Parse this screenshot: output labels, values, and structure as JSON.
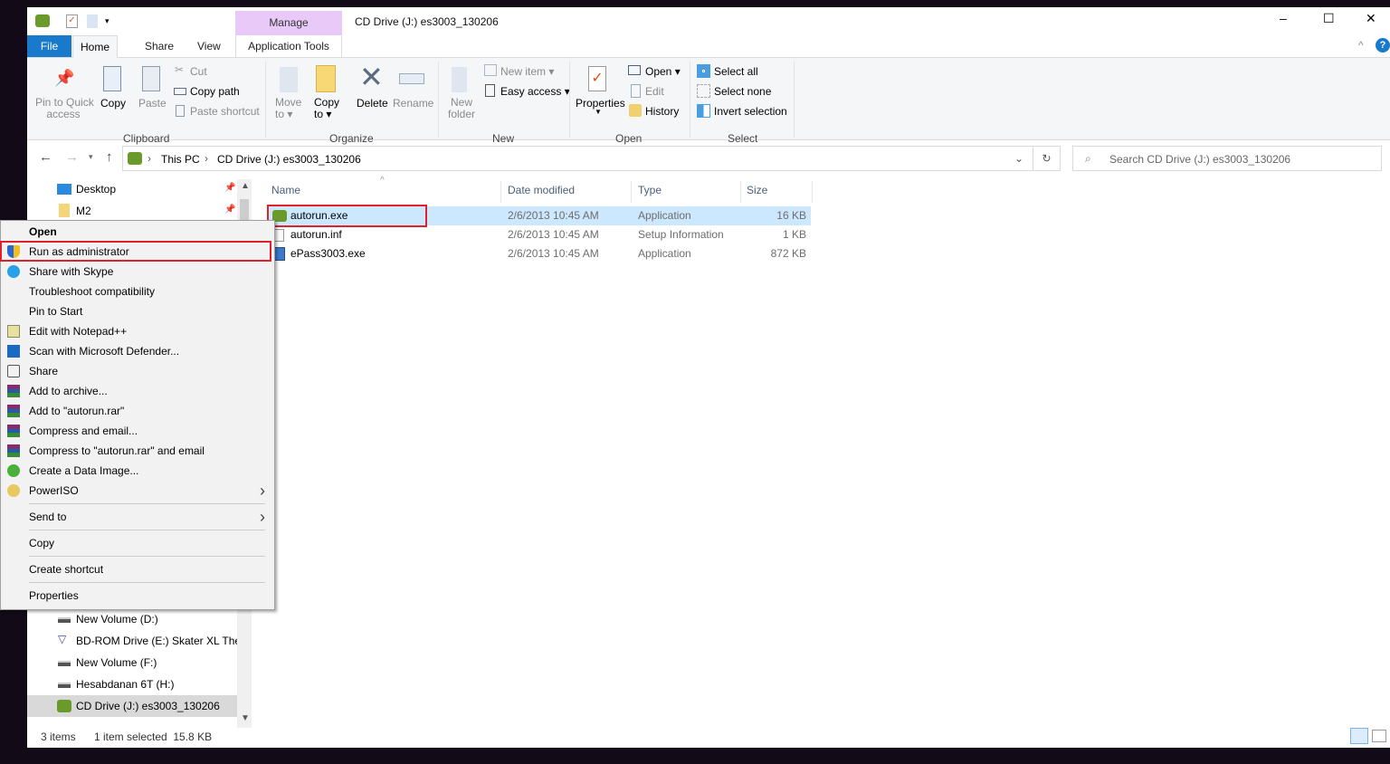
{
  "window": {
    "title": "CD Drive (J:) es3003_130206",
    "context_tab_group": "Manage",
    "minimize": "–",
    "maximize": "☐",
    "close": "✕"
  },
  "tabs": {
    "file": "File",
    "home": "Home",
    "share": "Share",
    "view": "View",
    "app_tools": "Application Tools"
  },
  "ribbon": {
    "clipboard": {
      "label": "Clipboard",
      "pin": [
        "Pin to Quick",
        "access"
      ],
      "copy": "Copy",
      "paste": "Paste",
      "cut": "Cut",
      "copy_path": "Copy path",
      "paste_shortcut": "Paste shortcut"
    },
    "organize": {
      "label": "Organize",
      "move_to": [
        "Move",
        "to ▾"
      ],
      "copy_to": [
        "Copy",
        "to ▾"
      ],
      "delete": "Delete",
      "rename": "Rename"
    },
    "new": {
      "label": "New",
      "new_folder": [
        "New",
        "folder"
      ],
      "new_item": "New item ▾",
      "easy_access": "Easy access ▾"
    },
    "open": {
      "label": "Open",
      "properties": "Properties",
      "open": "Open ▾",
      "edit": "Edit",
      "history": "History"
    },
    "select": {
      "label": "Select",
      "select_all": "Select all",
      "select_none": "Select none",
      "invert": "Invert selection"
    }
  },
  "address": {
    "crumbs": [
      "This PC",
      "CD Drive (J:) es3003_130206"
    ],
    "search_placeholder": "Search CD Drive (J:) es3003_130206"
  },
  "nav": {
    "top": [
      "Desktop",
      "M2"
    ],
    "bottom": [
      "New Volume (D:)",
      "BD-ROM Drive (E:) Skater XL The U",
      "New Volume (F:)",
      "Hesabdanan 6T (H:)",
      "CD Drive (J:) es3003_130206"
    ]
  },
  "columns": [
    "Name",
    "Date modified",
    "Type",
    "Size"
  ],
  "files": [
    {
      "name": "autorun.exe",
      "date": "2/6/2013 10:45 AM",
      "type": "Application",
      "size": "16 KB",
      "selected": true
    },
    {
      "name": "autorun.inf",
      "date": "2/6/2013 10:45 AM",
      "type": "Setup Information",
      "size": "1 KB"
    },
    {
      "name": "ePass3003.exe",
      "date": "2/6/2013 10:45 AM",
      "type": "Application",
      "size": "872 KB"
    }
  ],
  "context_menu": {
    "items": [
      {
        "label": "Open",
        "icon": "",
        "bold": true
      },
      {
        "label": "Run as administrator",
        "icon": "shield-icon",
        "highlight": true
      },
      {
        "label": "Share with Skype",
        "icon": "skype-icon"
      },
      {
        "label": "Troubleshoot compatibility",
        "icon": ""
      },
      {
        "label": "Pin to Start",
        "icon": ""
      },
      {
        "label": "Edit with Notepad++",
        "icon": "notepad-icon"
      },
      {
        "label": "Scan with Microsoft Defender...",
        "icon": "defender-icon"
      },
      {
        "label": "Share",
        "icon": "share-icon"
      },
      {
        "label": "Add to archive...",
        "icon": "winrar-icon"
      },
      {
        "label": "Add to \"autorun.rar\"",
        "icon": "winrar-icon"
      },
      {
        "label": "Compress and email...",
        "icon": "winrar-icon"
      },
      {
        "label": "Compress to \"autorun.rar\" and email",
        "icon": "winrar-icon"
      },
      {
        "label": "Create a Data Image...",
        "icon": "disc-icon"
      },
      {
        "label": "PowerISO",
        "icon": "poweriso-icon",
        "submenu": true
      },
      {
        "label": "Send to",
        "icon": "",
        "submenu": true
      },
      {
        "label": "Copy",
        "icon": ""
      },
      {
        "label": "Create shortcut",
        "icon": ""
      },
      {
        "label": "Properties",
        "icon": ""
      }
    ]
  },
  "status": {
    "count": "3 items",
    "selection": "1 item selected  15.8 KB"
  },
  "colors": {
    "accent": "#1979ca",
    "file_tab": "#1979ca",
    "manage_tab": "#e8c9f7",
    "selection": "#cce8ff",
    "highlight_border": "#e0202a"
  }
}
